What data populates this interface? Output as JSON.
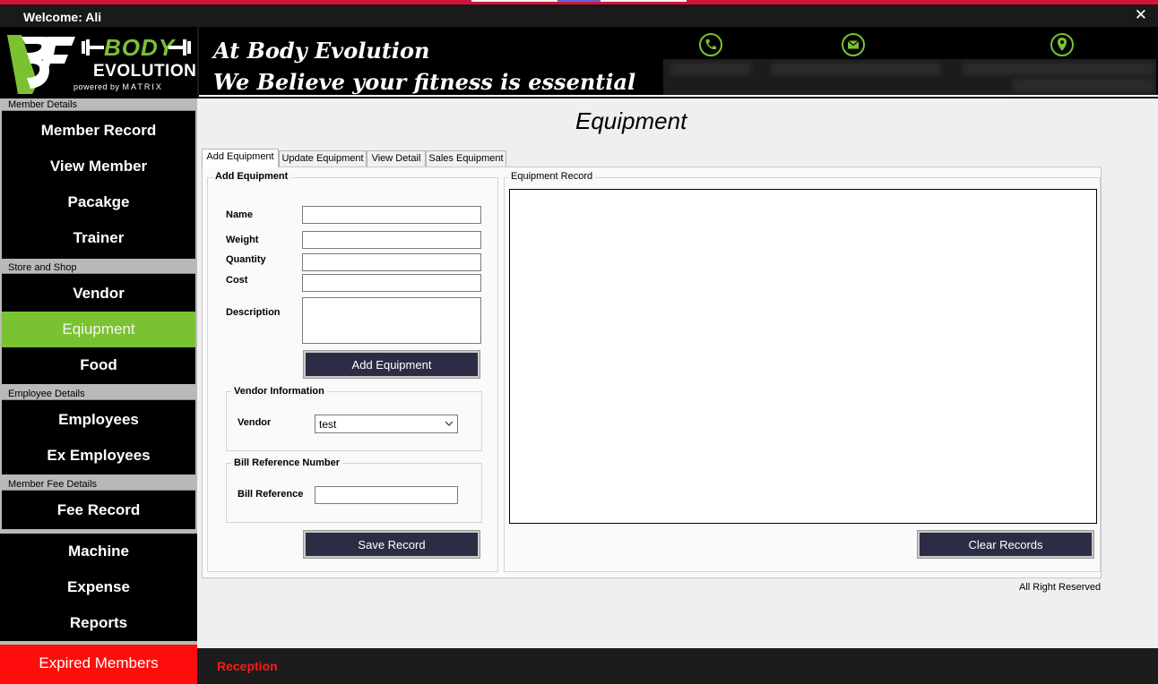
{
  "window": {
    "welcome": "Welcome: Ali",
    "close_symbol": "✕"
  },
  "brand": {
    "logo_mark": "BE",
    "logo_body": "BODY",
    "logo_evolution": "EVOLUTION",
    "logo_powered": "powered by",
    "logo_matrix": "MATRIX",
    "slogan_line1": "At Body Evolution",
    "slogan_line2": "We Believe your fitness is essential",
    "accent_color": "#7ac231",
    "contact_icons": [
      "phone-icon",
      "email-icon",
      "location-icon"
    ]
  },
  "sidebar": {
    "groups": [
      {
        "legend": "Member Details",
        "items": [
          "Member Record",
          "View Member",
          "Pacakge",
          "Trainer"
        ]
      },
      {
        "legend": "Store and Shop",
        "items": [
          "Vendor",
          "Eqiupment",
          "Food"
        ]
      },
      {
        "legend": "Employee Details",
        "items": [
          "Employees",
          "Ex Employees"
        ]
      },
      {
        "legend": "Member Fee Details",
        "items": [
          "Fee Record"
        ]
      }
    ],
    "extra_items": [
      "Machine",
      "Expense",
      "Reports"
    ],
    "expired": "Expired Members",
    "active_item": "Eqiupment",
    "active_color": "#7ac231",
    "expired_color": "#ff0d0d"
  },
  "page": {
    "title": "Equipment",
    "tabs": [
      "Add Equipment",
      "Update Equipment",
      "View Detail",
      "Sales Equipment"
    ],
    "active_tab": "Add Equipment",
    "add_section": {
      "legend": "Add Equipment",
      "fields": [
        {
          "label": "Name",
          "value": ""
        },
        {
          "label": "Weight",
          "value": ""
        },
        {
          "label": "Quantity",
          "value": ""
        },
        {
          "label": "Cost",
          "value": ""
        },
        {
          "label": "Description",
          "value": ""
        }
      ],
      "add_button": "Add Equipment"
    },
    "vendor_section": {
      "legend": "Vendor Information",
      "label": "Vendor",
      "selected": "test"
    },
    "bill_section": {
      "legend": "Bill Reference Number",
      "label": "Bill Reference",
      "value": ""
    },
    "save_button": "Save Record",
    "records": {
      "legend": "Equipment Record",
      "clear_button": "Clear Records"
    },
    "rights": "All Right Reserved"
  },
  "footer": {
    "role": "Reception"
  }
}
